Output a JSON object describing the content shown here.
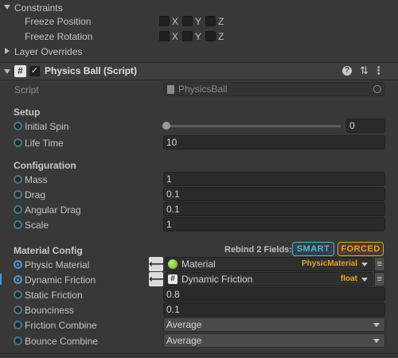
{
  "rigidbody": {
    "constraints_label": "Constraints",
    "freeze_position_label": "Freeze Position",
    "freeze_rotation_label": "Freeze Rotation",
    "axis_x": "X",
    "axis_y": "Y",
    "axis_z": "Z",
    "layer_overrides_label": "Layer Overrides"
  },
  "component": {
    "title": "Physics Ball (Script)",
    "enabled": true,
    "help_icon": "question-icon",
    "preset_icon": "sliders-icon",
    "menu_icon": "kebab-icon"
  },
  "script_row": {
    "label": "Script",
    "value": "PhysicsBall"
  },
  "setup": {
    "header": "Setup",
    "initial_spin_label": "Initial Spin",
    "initial_spin_value": "0",
    "initial_spin_fraction": 0,
    "life_time_label": "Life Time",
    "life_time_value": "10"
  },
  "configuration": {
    "header": "Configuration",
    "mass_label": "Mass",
    "mass_value": "1",
    "drag_label": "Drag",
    "drag_value": "0.1",
    "angular_drag_label": "Angular Drag",
    "angular_drag_value": "0.1",
    "scale_label": "Scale",
    "scale_value": "1"
  },
  "material_config": {
    "header": "Material Config",
    "rebind_label": "Rebind 2 Fields:",
    "smart_label": "SMART",
    "forced_label": "FORCED",
    "physic_material_label": "Physic Material",
    "physic_material_value": "Material",
    "physic_material_type": "PhysicMaterial",
    "dynamic_friction_label": "Dynamic Friction",
    "dynamic_friction_value": "Dynamic Friction",
    "dynamic_friction_type": "float",
    "static_friction_label": "Static Friction",
    "static_friction_value": "0.8",
    "bounciness_label": "Bounciness",
    "bounciness_value": "0.1",
    "friction_combine_label": "Friction Combine",
    "friction_combine_value": "Average",
    "bounce_combine_label": "Bounce Combine",
    "bounce_combine_value": "Average"
  },
  "colors": {
    "background": "#383838",
    "field": "#2a2a2a",
    "smart_accent": "#5bb0c9",
    "forced_accent": "#e0a040",
    "type_label": "#e6a623",
    "binding_ring": "#3f7a86",
    "bound_ring": "#4f93c9"
  }
}
